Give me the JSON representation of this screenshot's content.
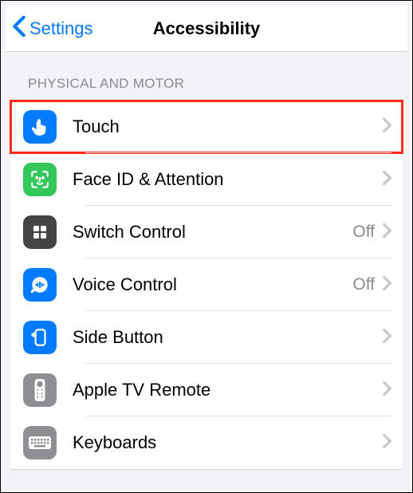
{
  "header": {
    "back_label": "Settings",
    "title": "Accessibility"
  },
  "section": {
    "title": "PHYSICAL AND MOTOR"
  },
  "rows": [
    {
      "label": "Touch",
      "value": "",
      "icon": "hand-tap-icon",
      "color": "#007aff",
      "highlighted": true
    },
    {
      "label": "Face ID & Attention",
      "value": "",
      "icon": "face-id-icon",
      "color": "#34c759",
      "highlighted": false
    },
    {
      "label": "Switch Control",
      "value": "Off",
      "icon": "switch-control-icon",
      "color": "#444446",
      "highlighted": false
    },
    {
      "label": "Voice Control",
      "value": "Off",
      "icon": "voice-control-icon",
      "color": "#007aff",
      "highlighted": false
    },
    {
      "label": "Side Button",
      "value": "",
      "icon": "side-button-icon",
      "color": "#007aff",
      "highlighted": false
    },
    {
      "label": "Apple TV Remote",
      "value": "",
      "icon": "apple-tv-remote-icon",
      "color": "#8e8e93",
      "highlighted": false
    },
    {
      "label": "Keyboards",
      "value": "",
      "icon": "keyboard-icon",
      "color": "#8e8e93",
      "highlighted": false
    }
  ]
}
